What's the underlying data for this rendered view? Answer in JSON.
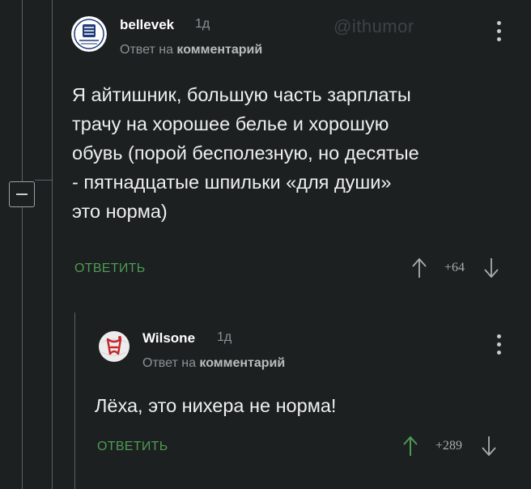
{
  "watermark": "@ithumor",
  "comments": [
    {
      "username": "bellevek",
      "time": "1д",
      "reply_prefix": "Ответ на",
      "reply_target": "комментарий",
      "lines": [
        "Я айтишник, большую часть зарплаты",
        "трачу на хорошее белье и хорошую",
        "обувь (порой бесполезную, но десятые",
        "- пятнадцатые шпильки «для души»",
        "это норма)"
      ],
      "reply_label": "ОТВЕТИТЬ",
      "score": "+64",
      "upvoted": false
    },
    {
      "username": "Wilsone",
      "time": "1д",
      "reply_prefix": "Ответ на",
      "reply_target": "комментарий",
      "lines": [
        "Лёха, это нихера не норма!"
      ],
      "reply_label": "ОТВЕТИТЬ",
      "score": "+289",
      "upvoted": true
    }
  ],
  "colors": {
    "background": "#1c2021",
    "accent_green": "#4f9a52",
    "muted_text": "#8c9294"
  }
}
